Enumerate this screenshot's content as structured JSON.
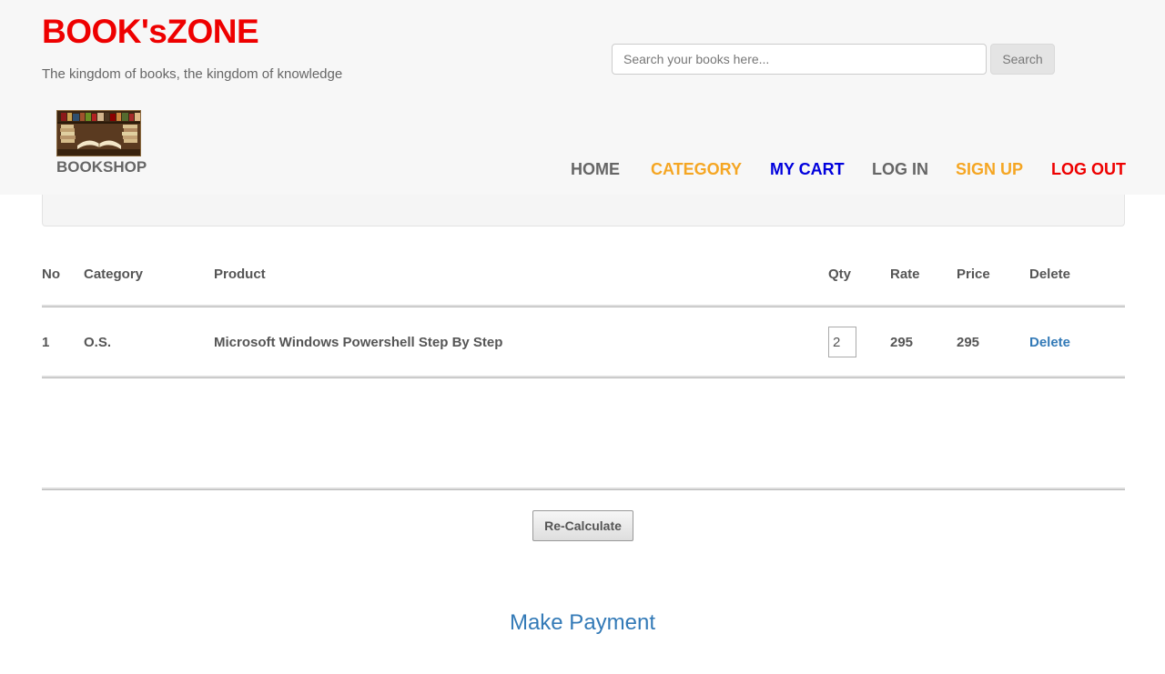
{
  "header": {
    "brand_title": "BOOK'sZONE",
    "tagline": "The kingdom of books, the kingdom of knowledge",
    "search_placeholder": "Search your books here...",
    "search_button": "Search",
    "logo_label": "BOOKSHOP",
    "logo_icon": "bookshelf-image-icon"
  },
  "nav": {
    "home": "HOME",
    "category": "CATEGORY",
    "cart": "MY CART",
    "login": "LOG IN",
    "signup": "SIGN UP",
    "logout": "LOG OUT",
    "colors": {
      "category": "#f5a623",
      "cart": "#0000dd",
      "signup": "#f5a623",
      "logout": "#ee0000"
    }
  },
  "cart_table": {
    "headers": {
      "no": "No",
      "category": "Category",
      "product": "Product",
      "qty": "Qty",
      "rate": "Rate",
      "price": "Price",
      "delete": "Delete"
    },
    "rows": [
      {
        "no": "1",
        "category": "O.S.",
        "product": "Microsoft Windows Powershell Step By Step",
        "qty": "2",
        "rate": "295",
        "price": "295",
        "delete_label": "Delete"
      }
    ]
  },
  "actions": {
    "recalculate": "Re-Calculate",
    "make_payment": "Make Payment"
  },
  "colors": {
    "brand": "#ee0000",
    "link": "#337ab7"
  }
}
